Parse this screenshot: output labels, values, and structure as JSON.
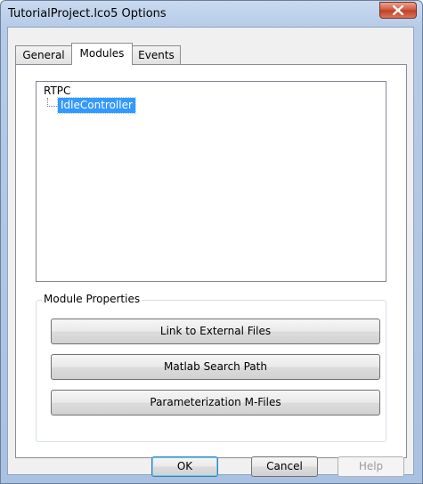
{
  "window": {
    "title": "TutorialProject.lco5 Options",
    "close_icon": "close-icon"
  },
  "tabs": [
    {
      "label": "General",
      "active": false
    },
    {
      "label": "Modules",
      "active": true
    },
    {
      "label": "Events",
      "active": false
    }
  ],
  "tree": {
    "root": "RTPC",
    "children": [
      {
        "label": "IdleController",
        "selected": true
      }
    ]
  },
  "module_properties": {
    "group_label": "Module Properties",
    "buttons": [
      {
        "label": "Link to External Files"
      },
      {
        "label": "Matlab Search Path"
      },
      {
        "label": "Parameterization M-Files"
      }
    ]
  },
  "footer": {
    "ok_label": "OK",
    "cancel_label": "Cancel",
    "help_label": "Help"
  },
  "colors": {
    "selection": "#3399ff",
    "close_button": "#c74a31"
  }
}
